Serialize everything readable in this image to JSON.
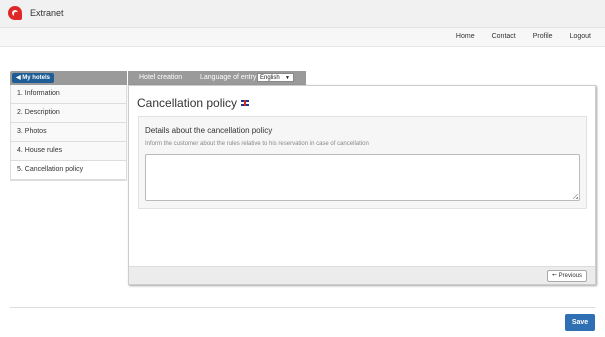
{
  "header": {
    "brand": "Extranet"
  },
  "nav": [
    "Home",
    "Contact",
    "Profile",
    "Logout"
  ],
  "sidebar": {
    "back_label": "My hotels",
    "items": [
      {
        "label": "1. Information"
      },
      {
        "label": "2. Description"
      },
      {
        "label": "3. Photos"
      },
      {
        "label": "4. House rules"
      },
      {
        "label": "5. Cancellation policy"
      }
    ]
  },
  "tabs": {
    "hotel_creation": "Hotel creation",
    "language_label": "Language of entry",
    "language_value": "English"
  },
  "panel": {
    "title": "Cancellation policy",
    "card_title": "Details about the cancellation policy",
    "card_help": "Inform the customer about the rules relative to his reservation in case of cancellation",
    "textarea_value": "",
    "previous_label": "Previous"
  },
  "save_label": "Save"
}
